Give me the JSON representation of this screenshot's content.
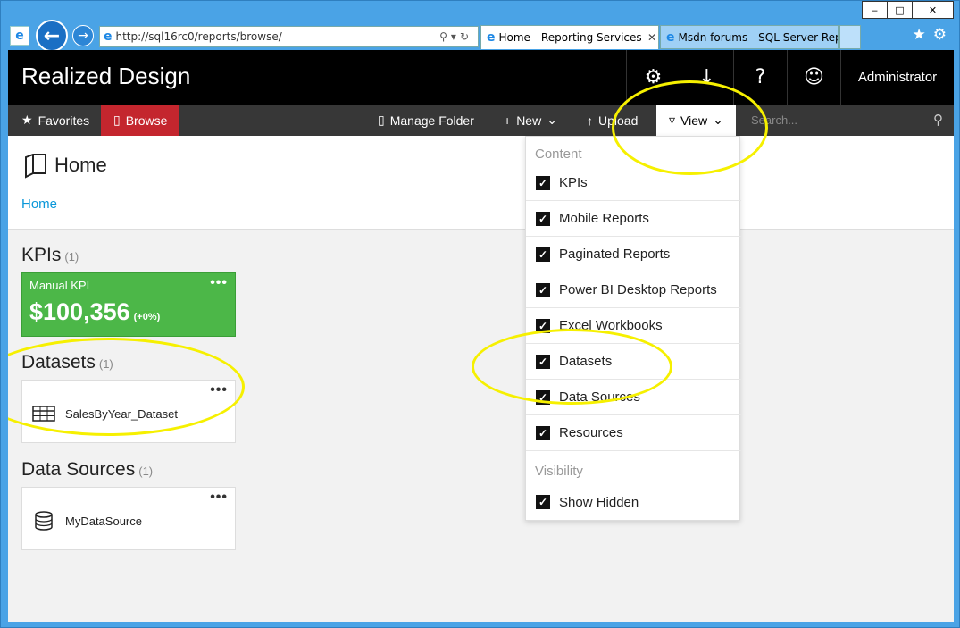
{
  "browser": {
    "url": "http://sql16rc0/reports/browse/",
    "tabs": [
      {
        "label": "Home - Reporting Services ..."
      },
      {
        "label": "Msdn forums - SQL Server Rep..."
      }
    ],
    "window_buttons": {
      "minimize": "‒",
      "maximize": "□",
      "close": "✕"
    }
  },
  "header": {
    "brand": "Realized Design",
    "user": "Administrator"
  },
  "toolbar": {
    "favorites": "Favorites",
    "browse": "Browse",
    "manage_folder": "Manage Folder",
    "new": "New",
    "upload": "Upload",
    "view": "View",
    "search_placeholder": "Search..."
  },
  "page": {
    "title": "Home",
    "breadcrumb": "Home"
  },
  "sections": {
    "kpis": {
      "title": "KPIs",
      "count": "(1)"
    },
    "datasets": {
      "title": "Datasets",
      "count": "(1)"
    },
    "datasources": {
      "title": "Data Sources",
      "count": "(1)"
    }
  },
  "kpi": {
    "name": "Manual KPI",
    "value": "$100,356",
    "delta": "(+0%)",
    "color": "#4cb748"
  },
  "dataset": {
    "label": "SalesByYear_Dataset"
  },
  "datasource": {
    "label": "MyDataSource"
  },
  "view_menu": {
    "content_heading": "Content",
    "content_items": [
      {
        "label": "KPIs",
        "checked": true
      },
      {
        "label": "Mobile Reports",
        "checked": true
      },
      {
        "label": "Paginated Reports",
        "checked": true
      },
      {
        "label": "Power BI Desktop Reports",
        "checked": true
      },
      {
        "label": "Excel Workbooks",
        "checked": true
      },
      {
        "label": "Datasets",
        "checked": true
      },
      {
        "label": "Data Sources",
        "checked": true
      },
      {
        "label": "Resources",
        "checked": true
      }
    ],
    "visibility_heading": "Visibility",
    "visibility_items": [
      {
        "label": "Show Hidden",
        "checked": true
      }
    ]
  },
  "colors": {
    "accent_red": "#c4262e",
    "header_black": "#000000",
    "toolbar_gray": "#373737",
    "link_blue": "#0a97d9",
    "annotation_yellow": "#f6f000"
  }
}
